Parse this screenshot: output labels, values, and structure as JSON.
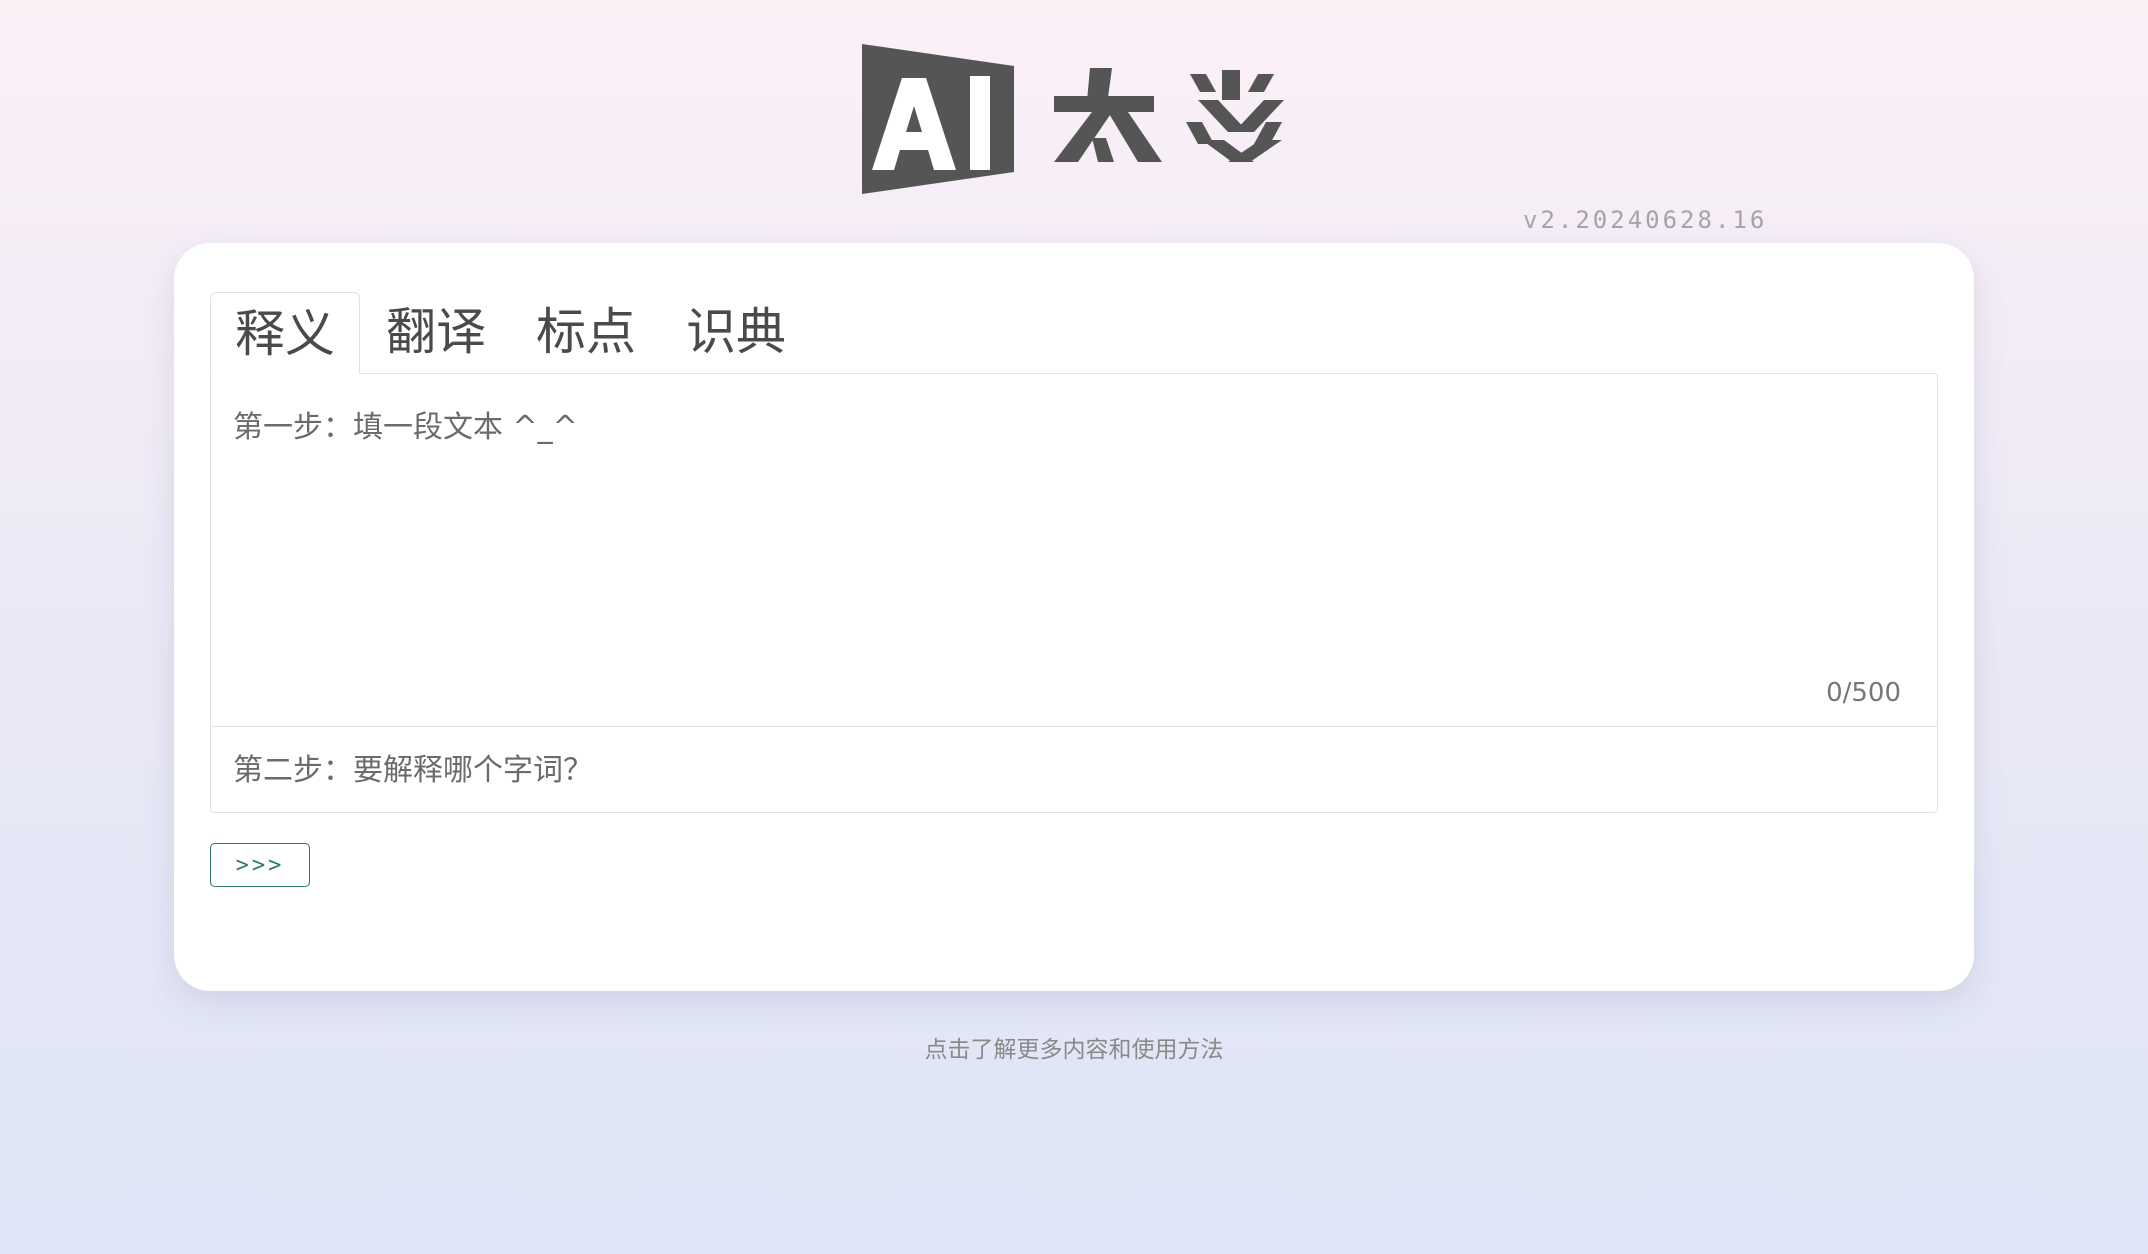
{
  "header": {
    "logo_text": "AI太炎",
    "version": "v2.20240628.16"
  },
  "tabs": [
    {
      "label": "释义",
      "active": true
    },
    {
      "label": "翻译",
      "active": false
    },
    {
      "label": "标点",
      "active": false
    },
    {
      "label": "识典",
      "active": false
    }
  ],
  "form": {
    "text_placeholder": "第一步：填一段文本 ^_^",
    "text_value": "",
    "counter": "0/500",
    "word_placeholder": "第二步：要解释哪个字词？",
    "word_value": "",
    "submit_label": ">>>"
  },
  "footer": {
    "link_text": "点击了解更多内容和使用方法"
  },
  "colors": {
    "logo": "#555555",
    "accent": "#2e7d5b"
  }
}
